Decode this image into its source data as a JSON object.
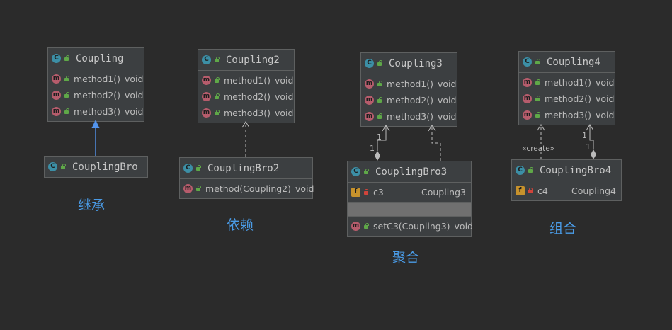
{
  "classes": {
    "coupling": {
      "name": "Coupling",
      "methods": [
        {
          "name": "method1()",
          "type": "void"
        },
        {
          "name": "method2()",
          "type": "void"
        },
        {
          "name": "method3()",
          "type": "void"
        }
      ]
    },
    "couplingBro": {
      "name": "CouplingBro"
    },
    "coupling2": {
      "name": "Coupling2",
      "methods": [
        {
          "name": "method1()",
          "type": "void"
        },
        {
          "name": "method2()",
          "type": "void"
        },
        {
          "name": "method3()",
          "type": "void"
        }
      ]
    },
    "couplingBro2": {
      "name": "CouplingBro2",
      "methods": [
        {
          "name": "method(Coupling2)",
          "type": "void"
        }
      ]
    },
    "coupling3": {
      "name": "Coupling3",
      "methods": [
        {
          "name": "method1()",
          "type": "void"
        },
        {
          "name": "method2()",
          "type": "void"
        },
        {
          "name": "method3()",
          "type": "void"
        }
      ]
    },
    "couplingBro3": {
      "name": "CouplingBro3",
      "fields": [
        {
          "name": "c3",
          "type": "Coupling3"
        }
      ],
      "methods": [
        {
          "name": "setC3(Coupling3)",
          "type": "void"
        }
      ]
    },
    "coupling4": {
      "name": "Coupling4",
      "methods": [
        {
          "name": "method1()",
          "type": "void"
        },
        {
          "name": "method2()",
          "type": "void"
        },
        {
          "name": "method3()",
          "type": "void"
        }
      ]
    },
    "couplingBro4": {
      "name": "CouplingBro4",
      "fields": [
        {
          "name": "c4",
          "type": "Coupling4"
        }
      ]
    }
  },
  "icons": {
    "class": "C",
    "method": "m",
    "field": "f"
  },
  "captions": {
    "inheritance": "继承",
    "dependency": "依赖",
    "aggregation": "聚合",
    "composition": "组合"
  },
  "edges": {
    "agg_mult_top": "1",
    "agg_mult_bottom": "1",
    "comp_mult_top": "1",
    "comp_mult_bottom": "1",
    "create_label": "«create»"
  },
  "colors": {
    "background": "#2b2b2b",
    "class_bg": "#3c3f41",
    "inheritance_arrow": "#5394ec",
    "caption": "#4a9be6"
  }
}
